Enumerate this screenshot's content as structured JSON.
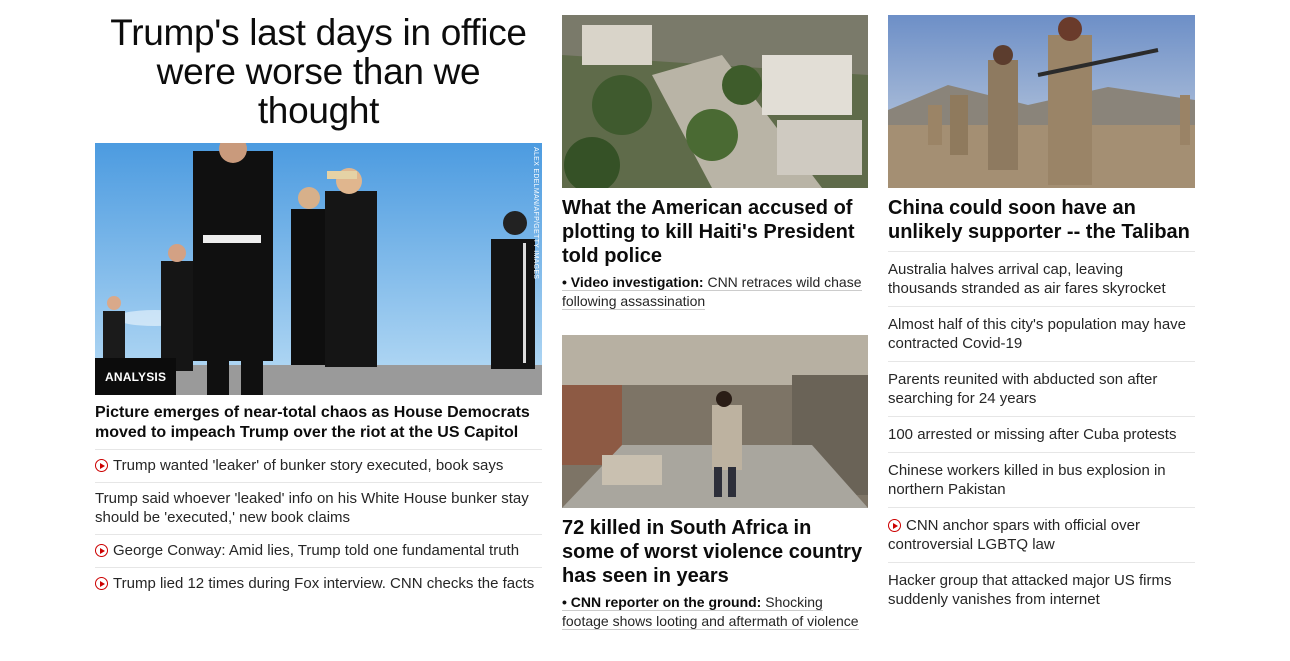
{
  "lead": {
    "headline": "Trump's last days in office were worse than we thought",
    "badge": "ANALYSIS",
    "photo_credit": "ALEX EDELMAN/AFP/GETTY IMAGES",
    "title": "Picture emerges of near-total chaos as House Democrats moved to impeach Trump over the riot at the US Capitol",
    "items": [
      {
        "text": "Trump wanted 'leaker' of bunker story executed, book says",
        "video": true
      },
      {
        "text": "Trump said whoever 'leaked' info on his White House bunker stay should be 'executed,' new book claims",
        "video": false
      },
      {
        "text": "George Conway: Amid lies, Trump told one fundamental truth",
        "video": true
      },
      {
        "text": "Trump lied 12 times during Fox interview. CNN checks the facts",
        "video": true
      }
    ]
  },
  "haiti": {
    "title": "What the American accused of plotting to kill Haiti's President told police",
    "sub_bold": "• Video investigation:",
    "sub_text": " CNN retraces wild chase following assassination"
  },
  "southafrica": {
    "title": "72 killed in South Africa in some of worst violence country has seen in years",
    "sub_bold": "• CNN reporter on the ground:",
    "sub_text": " Shocking footage shows looting and aftermath of violence"
  },
  "taliban": {
    "title": "China could soon have an unlikely supporter -- the Taliban",
    "items": [
      {
        "text": "Australia halves arrival cap, leaving thousands stranded as air fares skyrocket",
        "video": false
      },
      {
        "text": "Almost half of this city's population may have contracted Covid-19",
        "video": false
      },
      {
        "text": "Parents reunited with abducted son after searching for 24 years",
        "video": false
      },
      {
        "text": "100 arrested or missing after Cuba protests",
        "video": false
      },
      {
        "text": "Chinese workers killed in bus explosion in northern Pakistan",
        "video": false
      },
      {
        "text": "CNN anchor spars with official over controversial LGBTQ law",
        "video": true
      },
      {
        "text": "Hacker group that attacked major US firms suddenly vanishes from internet",
        "video": false
      }
    ]
  },
  "colors": {
    "accent_red": "#cc0000",
    "text": "#262626",
    "divider": "#e6e6e6"
  }
}
